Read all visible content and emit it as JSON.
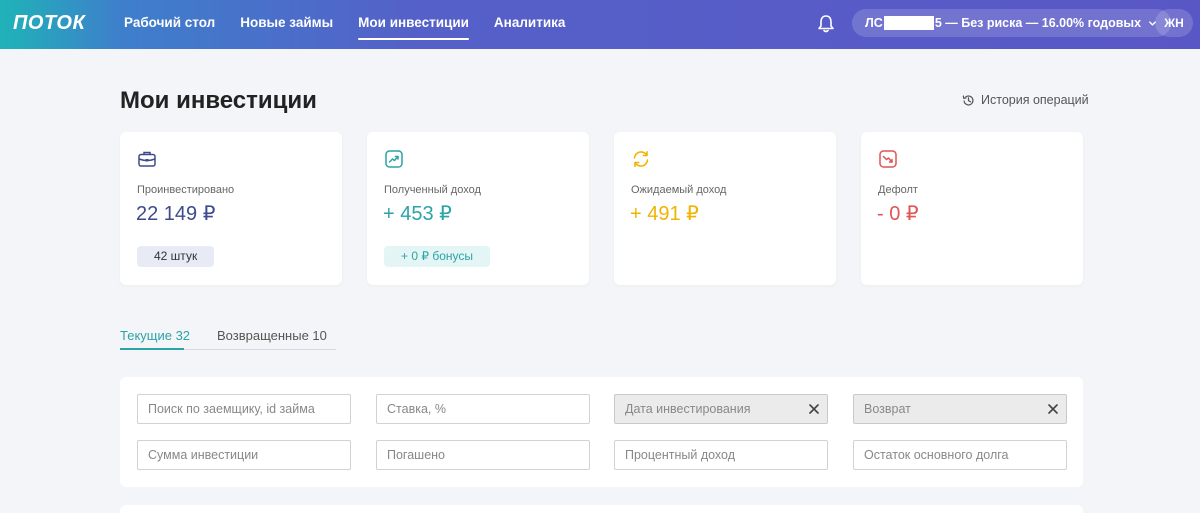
{
  "header": {
    "logo": "ПОТОК",
    "nav": [
      {
        "label": "Рабочий стол",
        "active": false
      },
      {
        "label": "Новые займы",
        "active": false
      },
      {
        "label": "Мои инвестиции",
        "active": true
      },
      {
        "label": "Аналитика",
        "active": false
      }
    ],
    "account": {
      "prefix": "ЛС",
      "suffix": "5 — Без риска — 16.00% годовых"
    },
    "avatar": "ЖН"
  },
  "page": {
    "title": "Мои инвестиции",
    "history_link": "История операций"
  },
  "cards": [
    {
      "icon": "briefcase-icon",
      "label": "Проинвестировано",
      "value": "22 149 ₽",
      "color": "#3d4a8c",
      "chip": "42 штук",
      "chip_bg": "#e8ebf5",
      "chip_color": "#333"
    },
    {
      "icon": "trend-up-icon",
      "label": "Полученный доход",
      "value": "+ 453 ₽",
      "color": "#2ca3a5",
      "chip": "+ 0 ₽ бонусы",
      "chip_bg": "#e3f5f4",
      "chip_color": "#2ca3a5"
    },
    {
      "icon": "refresh-icon",
      "label": "Ожидаемый доход",
      "value": "+ 491 ₽",
      "color": "#f0b400"
    },
    {
      "icon": "trend-down-icon",
      "label": "Дефолт",
      "value": "- 0 ₽",
      "color": "#e05555"
    }
  ],
  "tabs": [
    {
      "label": "Текущие 32",
      "active": true
    },
    {
      "label": "Возвращенные 10",
      "active": false
    }
  ],
  "filters": {
    "row1": [
      {
        "placeholder": "Поиск по заемщику, id займа",
        "disabled": false
      },
      {
        "placeholder": "Ставка, %",
        "disabled": false
      },
      {
        "placeholder": "Дата инвестирования",
        "disabled": true
      },
      {
        "placeholder": "Возврат",
        "disabled": true
      }
    ],
    "row2": [
      {
        "placeholder": "Сумма инвестиции",
        "disabled": false
      },
      {
        "placeholder": "Погашено",
        "disabled": false
      },
      {
        "placeholder": "Процентный доход",
        "disabled": false
      },
      {
        "placeholder": "Остаток основного долга",
        "disabled": false
      }
    ]
  }
}
